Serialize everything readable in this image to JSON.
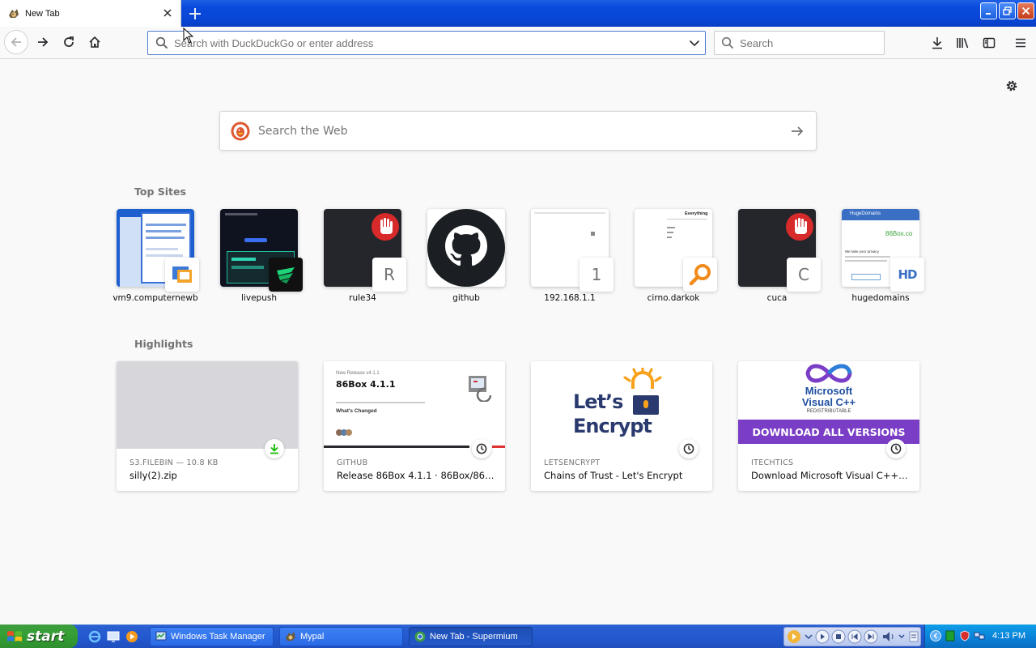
{
  "browser": {
    "tab": {
      "title": "New Tab"
    },
    "urlbar": {
      "placeholder": "Search with DuckDuckGo or enter address",
      "value": ""
    },
    "searchbar": {
      "placeholder": "Search"
    }
  },
  "newtab": {
    "web_search_placeholder": "Search the Web",
    "top_sites_title": "Top Sites",
    "highlights_title": "Highlights",
    "top_sites": [
      {
        "label": "vm9.computernewb",
        "icon": "computernewb-favicon"
      },
      {
        "label": "livepush",
        "icon": "livepush-favicon"
      },
      {
        "label": "rule34",
        "icon_letter": "R"
      },
      {
        "label": "github",
        "icon": "github-octocat"
      },
      {
        "label": "192.168.1.1",
        "icon_letter": "1"
      },
      {
        "label": "cirno.darkok",
        "icon": "search-key-favicon"
      },
      {
        "label": "cuca",
        "icon_letter": "C"
      },
      {
        "label": "hugedomains",
        "icon_letter": "HD"
      }
    ],
    "top_site_text": {
      "livepush_banner": "End-to-end Live st",
      "cirno_header": "Everything",
      "hugedomains_header": "HugeDomains",
      "hugedomains_domain": "86Box.co",
      "hugedomains_privacy": "We take your privacy"
    },
    "highlights": [
      {
        "context": "S3.FILEBIN — 10.8 KB",
        "title": "silly(2).zip",
        "badge": "download"
      },
      {
        "context": "GITHUB",
        "title": "Release 86Box 4.1.1 · 86Box/86Box",
        "badge": "history",
        "image_text": {
          "kicker": "New Release v4.1.1",
          "heading": "86Box 4.1.1",
          "sub": "What's Changed"
        }
      },
      {
        "context": "LETSENCRYPT",
        "title": "Chains of Trust - Let's Encrypt",
        "badge": "history",
        "image_text": {
          "line1": "Let’s",
          "line2": "Encrypt"
        }
      },
      {
        "context": "ITECHTICS",
        "title": "Download Microsoft Visual C++ Redistributable (All Versions)",
        "badge": "history",
        "image_text": {
          "brand": "Microsoft",
          "product": "Visual C++",
          "tag": "REDISTRIBUTABLE",
          "banner": "DOWNLOAD ALL VERSIONS"
        }
      }
    ]
  },
  "taskbar": {
    "start_label": "start",
    "tasks": [
      {
        "label": "Windows Task Manager",
        "active": false
      },
      {
        "label": "Mypal",
        "active": false
      },
      {
        "label": "New Tab - Supermium",
        "active": true
      }
    ],
    "clock": "4:13 PM"
  },
  "colors": {
    "titlebar": "#0846d6",
    "accent": "#4e7bd1",
    "page_bg": "#f9f9fa",
    "taskbar": "#245ad0",
    "start_green": "#35a035"
  }
}
